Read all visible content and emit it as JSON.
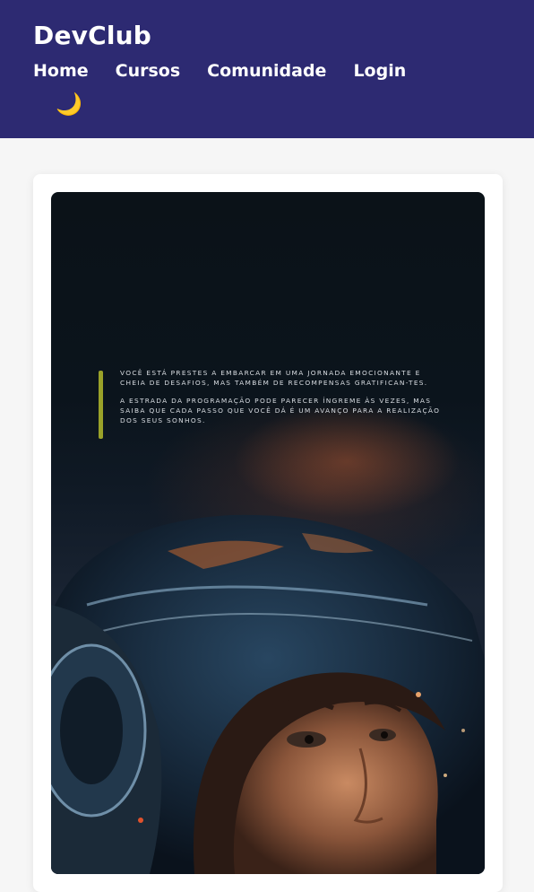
{
  "header": {
    "logo": "DevClub",
    "nav": [
      {
        "label": "Home"
      },
      {
        "label": "Cursos"
      },
      {
        "label": "Comunidade"
      },
      {
        "label": "Login"
      }
    ],
    "theme_toggle_icon": "crescent-moon-icon",
    "theme_toggle_glyph": "🌙",
    "bg_color": "#2d2a72"
  },
  "poster": {
    "accent_color": "#9aa229",
    "paragraph_1": "VOCÊ ESTÁ PRESTES A EMBARCAR EM UMA JORNADA EMOCIONANTE E CHEIA DE DESAFIOS, MAS TAMBÉM DE RECOMPENSAS GRATIFICAN-TES.",
    "paragraph_2": "A ESTRADA DA PROGRAMAÇÃO PODE PARECER ÍNGREME ÀS VEZES, MAS SAIBA QUE CADA PASSO QUE VOCÊ DÁ É UM AVANÇO PARA A REALIZAÇÃO DOS SEUS SONHOS."
  }
}
